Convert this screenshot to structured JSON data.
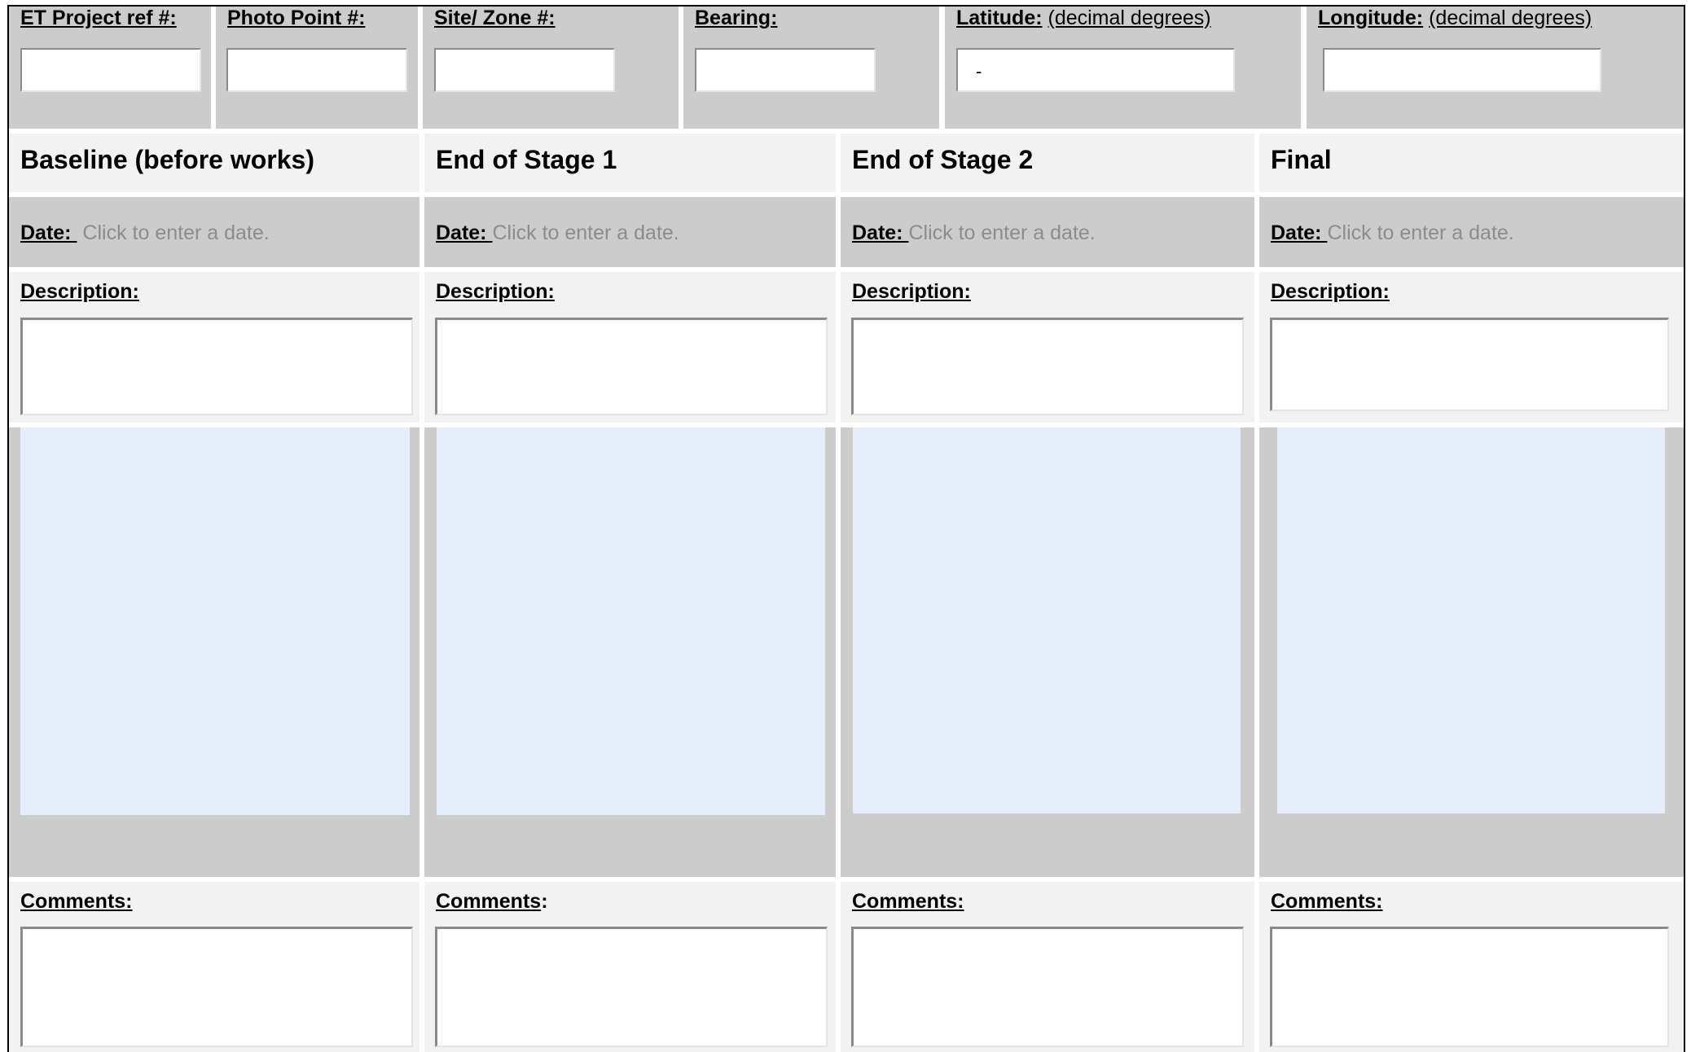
{
  "header": {
    "project_ref": "ET Project ref #:",
    "photo_point": "Photo Point #:",
    "site_zone": "Site/ Zone #:",
    "bearing": "Bearing:",
    "latitude": "Latitude:",
    "latitude_unit": "(decimal degrees)",
    "latitude_value": "-",
    "longitude": "Longitude:",
    "longitude_unit": "(decimal degrees)"
  },
  "stages": [
    {
      "title": "Baseline (before works)",
      "date_label": "Date: ",
      "date_placeholder": "Click to enter a date.",
      "description_label": "Description:",
      "comments_label": "Comments:"
    },
    {
      "title": "End of Stage 1",
      "date_label": "Date: ",
      "date_placeholder": "Click to enter a date.",
      "description_label": "Description:",
      "comments_label": "Comments",
      "comments_suffix": ":"
    },
    {
      "title": "End of Stage 2",
      "date_label": "Date: ",
      "date_placeholder": "Click to enter a date.",
      "description_label": "Description:",
      "comments_label": "Comments:"
    },
    {
      "title": "Final",
      "date_label": "Date: ",
      "date_placeholder": "Click to enter a date.",
      "description_label": "Description:",
      "comments_label": "Comments:"
    }
  ],
  "colors": {
    "cell_grey": "#cccccc",
    "cell_light": "#f2f2f2",
    "photo_placeholder": "#e6edfa",
    "placeholder_text": "#8c8c8c"
  }
}
